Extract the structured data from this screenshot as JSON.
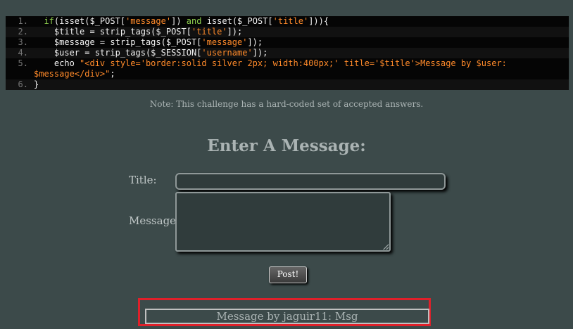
{
  "page": {
    "top_text": "",
    "note": "Note: This challenge has a hard-coded set of accepted answers.",
    "heading": "Enter A Message:"
  },
  "code": {
    "lines": [
      {
        "num": "1.",
        "text": "  if(isset($_POST['message']) and isset($_POST['title'])){"
      },
      {
        "num": "2.",
        "text": "    $title = strip_tags($_POST['title']);"
      },
      {
        "num": "3.",
        "text": "    $message = strip_tags($_POST['message']);"
      },
      {
        "num": "4.",
        "text": "    $user = strip_tags($_SESSION['username']);"
      },
      {
        "num": "5.",
        "text": "    echo \"<div style='border:solid silver 2px; width:400px;' title='$title'>Message by $user: $message</div>\";"
      },
      {
        "num": "6.",
        "text": "}"
      }
    ]
  },
  "form": {
    "title_label": "Title:",
    "message_label": "Message:",
    "title_value": "",
    "message_value": "",
    "submit_label": "Post!"
  },
  "output": {
    "message_text": "Message by jaguir11: Msg"
  },
  "colors": {
    "background": "#3c4a4a",
    "highlight": "#e0202a",
    "keyword": "#8fd14f",
    "string": "#ff8a2a"
  }
}
